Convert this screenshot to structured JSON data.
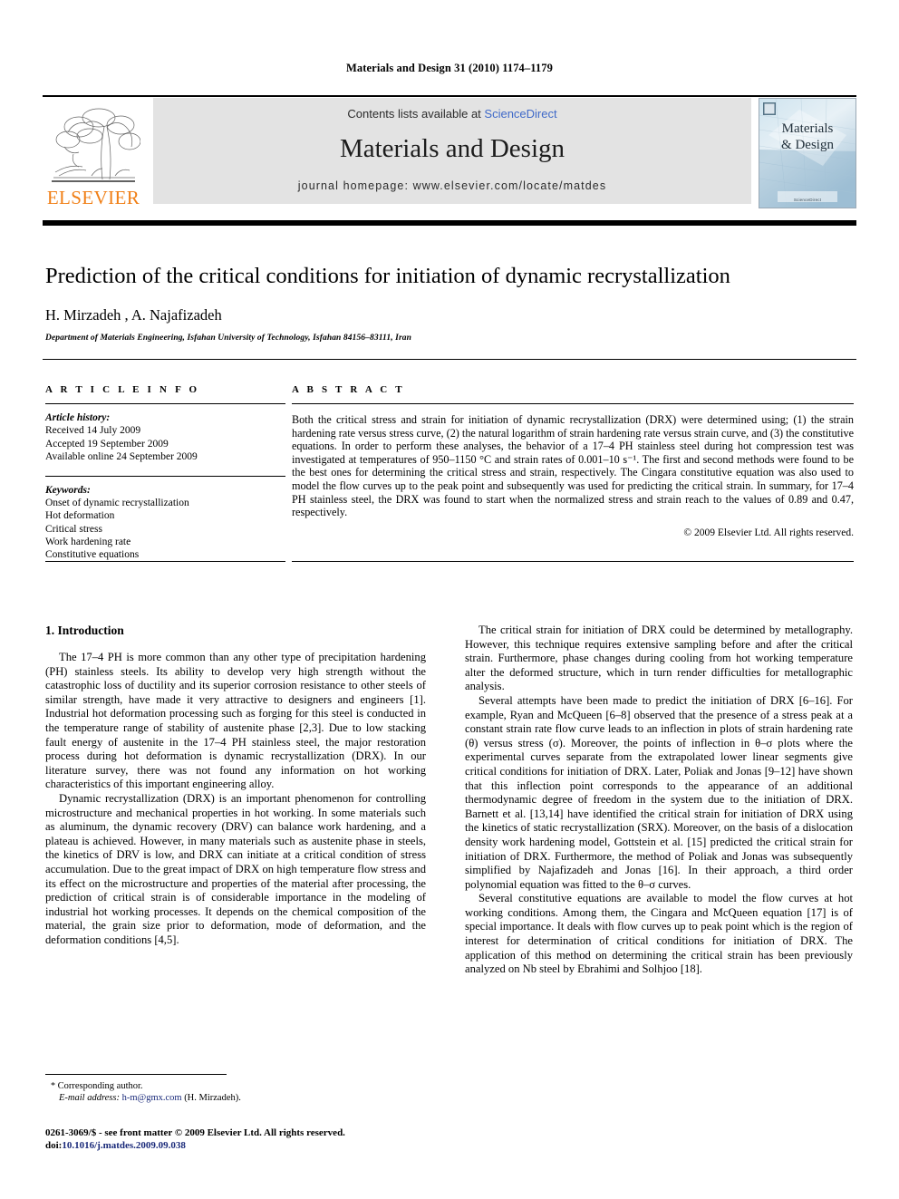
{
  "running_head": "Materials and Design 31 (2010) 1174–1179",
  "journal_header": {
    "contents_prefix": "Contents lists available at ",
    "sciencedirect": "ScienceDirect",
    "journal_name": "Materials and Design",
    "homepage": "journal homepage: www.elsevier.com/locate/matdes",
    "publisher_logo_text": "ELSEVIER",
    "cover_title_line1": "Materials",
    "cover_title_line2": "& Design",
    "cover_footer": "ScienceDirect"
  },
  "title": "Prediction of the critical conditions for initiation of dynamic recrystallization",
  "authors": "H. Mirzadeh , A. Najafizadeh",
  "author_marker": "*",
  "affiliation": "Department of Materials Engineering, Isfahan University of Technology, Isfahan 84156–83111, Iran",
  "article_info": {
    "heading": "A R T I C L E   I N F O",
    "history_label": "Article history:",
    "history": [
      "Received 14 July 2009",
      "Accepted 19 September 2009",
      "Available online 24 September 2009"
    ],
    "keywords_label": "Keywords:",
    "keywords": [
      "Onset of dynamic recrystallization",
      "Hot deformation",
      "Critical stress",
      "Work hardening rate",
      "Constitutive equations"
    ]
  },
  "abstract": {
    "heading": "A B S T R A C T",
    "text": "Both the critical stress and strain for initiation of dynamic recrystallization (DRX) were determined using; (1) the strain hardening rate versus stress curve, (2) the natural logarithm of strain hardening rate versus strain curve, and (3) the constitutive equations. In order to perform these analyses, the behavior of a 17–4 PH stainless steel during hot compression test was investigated at temperatures of 950–1150 °C and strain rates of 0.001–10 s⁻¹. The first and second methods were found to be the best ones for determining the critical stress and strain, respectively. The Cingara constitutive equation was also used to model the flow curves up to the peak point and subsequently was used for predicting the critical strain. In summary, for 17–4 PH stainless steel, the DRX was found to start when the normalized stress and strain reach to the values of 0.89 and 0.47, respectively.",
    "copyright": "© 2009 Elsevier Ltd. All rights reserved."
  },
  "section": {
    "number_title": "1. Introduction"
  },
  "left_column_paragraphs": [
    "The 17–4 PH is more common than any other type of precipitation hardening (PH) stainless steels. Its ability to develop very high strength without the catastrophic loss of ductility and its superior corrosion resistance to other steels of similar strength, have made it very attractive to designers and engineers [1]. Industrial hot deformation processing such as forging for this steel is conducted in the temperature range of stability of austenite phase [2,3]. Due to low stacking fault energy of austenite in the 17–4 PH stainless steel, the major restoration process during hot deformation is dynamic recrystallization (DRX). In our literature survey, there was not found any information on hot working characteristics of this important engineering alloy.",
    "Dynamic recrystallization (DRX) is an important phenomenon for controlling microstructure and mechanical properties in hot working. In some materials such as aluminum, the dynamic recovery (DRV) can balance work hardening, and a plateau is achieved. However, in many materials such as austenite phase in steels, the kinetics of DRV is low, and DRX can initiate at a critical condition of stress accumulation. Due to the great impact of DRX on high temperature flow stress and its effect on the microstructure and properties of the material after processing, the prediction of critical strain is of considerable importance in the modeling of industrial hot working processes. It depends on the chemical composition of the material, the grain size prior to deformation, mode of deformation, and the deformation conditions [4,5]."
  ],
  "right_column_paragraphs": [
    "The critical strain for initiation of DRX could be determined by metallography. However, this technique requires extensive sampling before and after the critical strain. Furthermore, phase changes during cooling from hot working temperature alter the deformed structure, which in turn render difficulties for metallographic analysis.",
    "Several attempts have been made to predict the initiation of DRX [6–16]. For example, Ryan and McQueen [6–8] observed that the presence of a stress peak at a constant strain rate flow curve leads to an inflection in plots of strain hardening rate (θ) versus stress (σ). Moreover, the points of inflection in θ–σ plots where the experimental curves separate from the extrapolated lower linear segments give critical conditions for initiation of DRX. Later, Poliak and Jonas [9–12] have shown that this inflection point corresponds to the appearance of an additional thermodynamic degree of freedom in the system due to the initiation of DRX. Barnett et al. [13,14] have identified the critical strain for initiation of DRX using the kinetics of static recrystallization (SRX). Moreover, on the basis of a dislocation density work hardening model, Gottstein et al. [15] predicted the critical strain for initiation of DRX. Furthermore, the method of Poliak and Jonas was subsequently simplified by Najafizadeh and Jonas [16]. In their approach, a third order polynomial equation was fitted to the θ–σ curves.",
    "Several constitutive equations are available to model the flow curves at hot working conditions. Among them, the Cingara and McQueen equation [17] is of special importance. It deals with flow curves up to peak point which is the region of interest for determination of critical conditions for initiation of DRX. The application of this method on determining the critical strain has been previously analyzed on Nb steel by Ebrahimi and Solhjoo [18]."
  ],
  "footnote": {
    "star": "*",
    "corresponding": "Corresponding author.",
    "email_label": "E-mail address:",
    "email": "h-m@gmx.com",
    "email_suffix": "(H. Mirzadeh)."
  },
  "issn_block": {
    "line1": "0261-3069/$ - see front matter © 2009 Elsevier Ltd. All rights reserved.",
    "doi_label": "doi:",
    "doi": "10.1016/j.matdes.2009.09.038"
  },
  "colors": {
    "link_blue": "#3f69c8",
    "ref_blue": "#1a2a7a",
    "elsevier_orange": "#f07f16",
    "band_grey": "#e3e3e3"
  }
}
